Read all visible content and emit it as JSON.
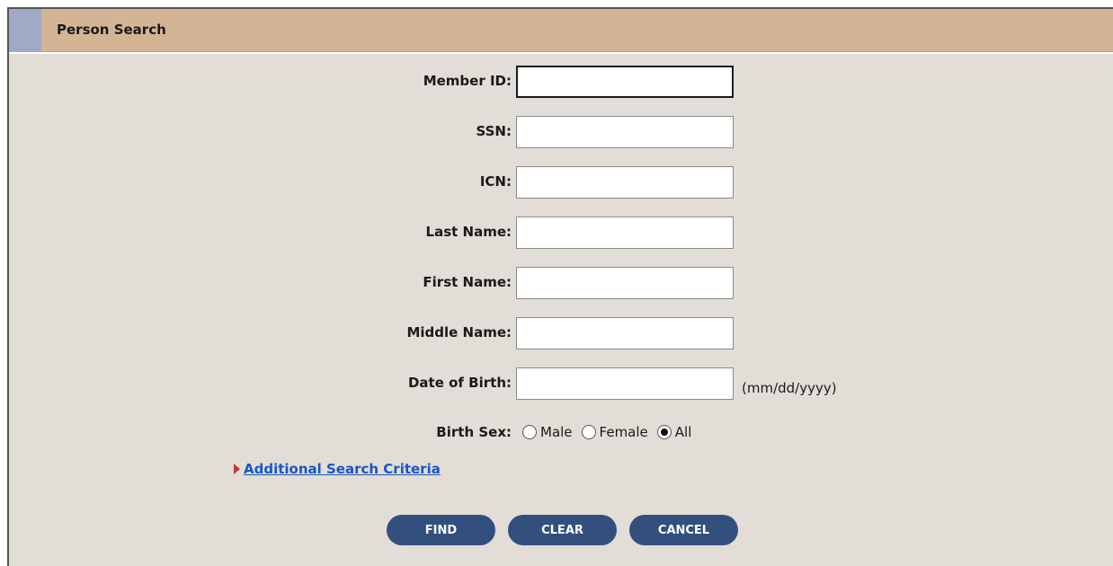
{
  "header": {
    "title": "Person Search"
  },
  "fields": [
    {
      "label": "Member ID:",
      "value": ""
    },
    {
      "label": "SSN:",
      "value": ""
    },
    {
      "label": "ICN:",
      "value": ""
    },
    {
      "label": "Last Name:",
      "value": ""
    },
    {
      "label": "First Name:",
      "value": ""
    },
    {
      "label": "Middle Name:",
      "value": ""
    },
    {
      "label": "Date of Birth:",
      "value": "",
      "hint": "(mm/dd/yyyy)"
    }
  ],
  "birth_sex": {
    "label": "Birth Sex:",
    "options": [
      "Male",
      "Female",
      "All"
    ],
    "selected": "All"
  },
  "additional": {
    "label": "Additional Search Criteria"
  },
  "buttons": {
    "find": "FIND",
    "clear": "CLEAR",
    "cancel": "CANCEL"
  },
  "colors": {
    "panel_bg": "#e2ddd6",
    "header_bg": "#d3b595",
    "header_accent": "#a0aac7",
    "button_bg": "#334f7e",
    "link": "#1757c7",
    "arrow": "#c13b3b"
  }
}
